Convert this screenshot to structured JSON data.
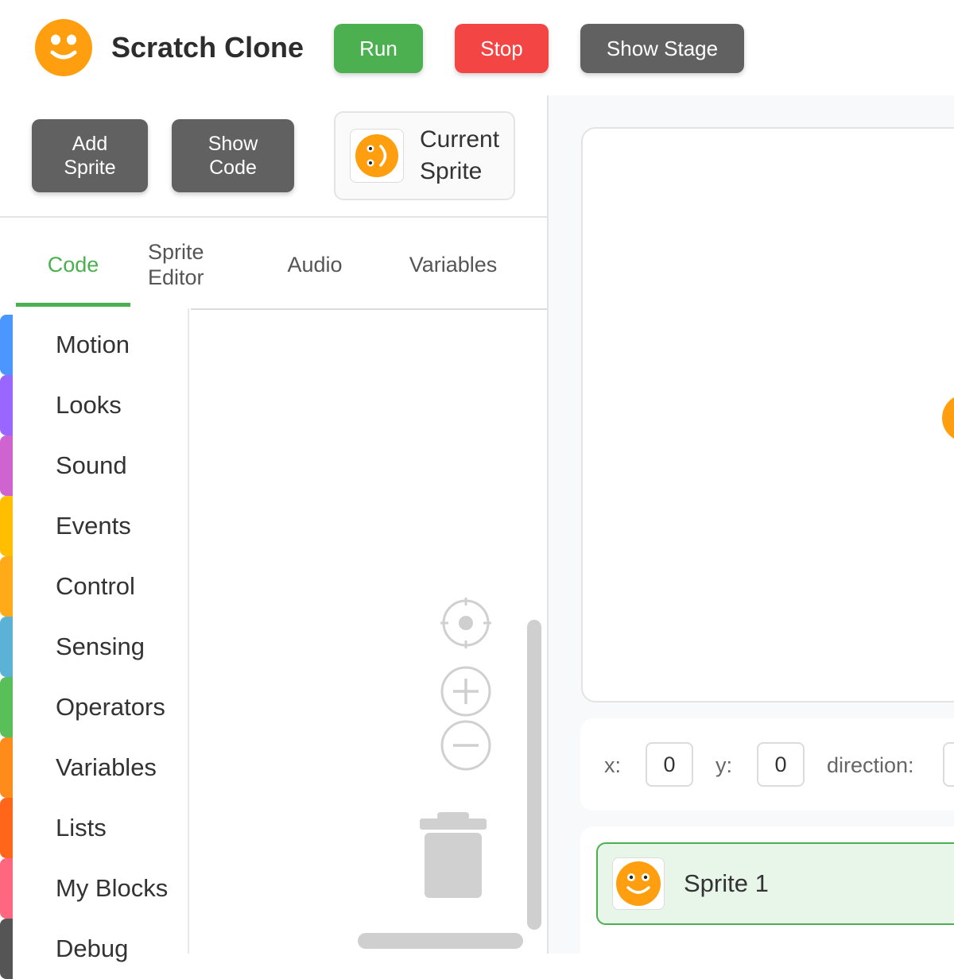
{
  "app": {
    "title": "Scratch Clone",
    "accent": "#4caf50",
    "logo_color": "#ff9f0f"
  },
  "header": {
    "run_label": "Run",
    "stop_label": "Stop",
    "show_stage_label": "Show Stage"
  },
  "toolbar": {
    "add_sprite_label": [
      "Add",
      "Sprite"
    ],
    "show_code_label": [
      "Show",
      "Code"
    ],
    "current_sprite_label": [
      "Current",
      "Sprite"
    ]
  },
  "tabs": [
    {
      "label": "Code",
      "active": true
    },
    {
      "label": "Sprite Editor",
      "lines": [
        "Sprite",
        "Editor"
      ]
    },
    {
      "label": "Audio"
    },
    {
      "label": "Variables"
    }
  ],
  "categories": [
    {
      "label": "Motion",
      "color": "#4c97ff"
    },
    {
      "label": "Looks",
      "color": "#9966ff"
    },
    {
      "label": "Sound",
      "color": "#cf63cf"
    },
    {
      "label": "Events",
      "color": "#ffbf00"
    },
    {
      "label": "Control",
      "color": "#ffab19"
    },
    {
      "label": "Sensing",
      "color": "#5cb1d6"
    },
    {
      "label": "Operators",
      "color": "#59c059"
    },
    {
      "label": "Variables",
      "color": "#ff8c1a"
    },
    {
      "label": "Lists",
      "color": "#ff661a"
    },
    {
      "label": "My Blocks",
      "color": "#ff6680"
    },
    {
      "label": "Debug",
      "color": "#555555"
    }
  ],
  "workspace_icons": [
    "recenter-icon",
    "zoom-in-icon",
    "zoom-out-icon",
    "trash-icon"
  ],
  "stage": {
    "x_label": "x:",
    "x_value": "0",
    "y_label": "y:",
    "y_value": "0",
    "direction_label": "direction:"
  },
  "sprites": [
    {
      "name": "Sprite 1",
      "selected": true
    }
  ]
}
